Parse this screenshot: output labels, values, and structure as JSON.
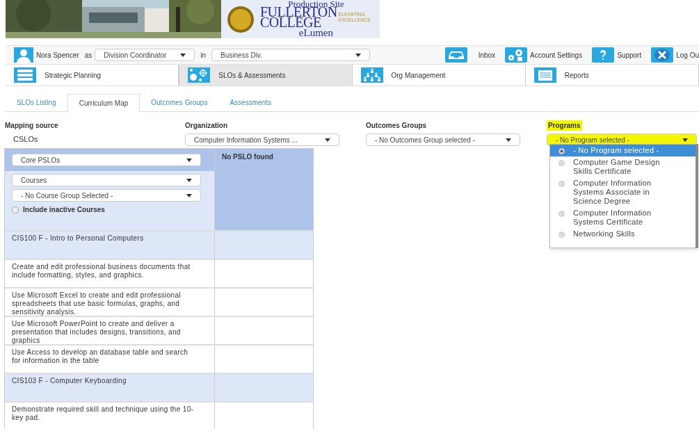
{
  "banner": {
    "site_label": "Production Site",
    "college_name": [
      "FULLERTON",
      "COLLEGE"
    ],
    "tagline": [
      "ELEVATING.",
      "EXCELLENCE."
    ],
    "product": "eLumen"
  },
  "user_bar": {
    "user": "Nora Spencer",
    "as_label": "as",
    "role": "Division Coordinator",
    "in_label": "in",
    "division": "Business Div.",
    "links": [
      {
        "label": "Inbox",
        "kind": "inbox"
      },
      {
        "label": "Account Settings",
        "kind": "settings"
      },
      {
        "label": "Support",
        "kind": "help"
      },
      {
        "label": "Log Ou",
        "kind": "logout"
      }
    ]
  },
  "modules": [
    {
      "label": "Strategic Planning",
      "kind": "planning",
      "selected": false
    },
    {
      "label": "SLOs & Assessments",
      "kind": "slo",
      "selected": true
    },
    {
      "label": "Org Management",
      "kind": "org",
      "selected": false
    },
    {
      "label": "Reports",
      "kind": "reports",
      "selected": false
    }
  ],
  "tabs": [
    {
      "label": "SLOs Listing",
      "selected": false
    },
    {
      "label": "Curriculum Map",
      "selected": true
    },
    {
      "label": "Outcomes Groups",
      "selected": false
    },
    {
      "label": "Assessments",
      "selected": false
    }
  ],
  "filters": {
    "mapping_source": {
      "label": "Mapping source",
      "value": "CSLOs"
    },
    "organization": {
      "label": "Organization",
      "value": "Computer Information Systems ..."
    },
    "outcomes_groups": {
      "label": "Outcomes Groups",
      "value": "- No Outcomes Group selected -"
    },
    "programs": {
      "label": "Programs",
      "value": "- No Program selected -",
      "highlighted": true,
      "options": [
        {
          "label": "- No Program selected -",
          "selected": true
        },
        {
          "label": "Computer Game Design Skills Certificate",
          "selected": false
        },
        {
          "label": "Computer Information Systems Associate in Science Degree",
          "selected": false
        },
        {
          "label": "Computer Information Systems Certificate",
          "selected": false
        },
        {
          "label": "Networking Skills",
          "selected": false
        }
      ]
    }
  },
  "map": {
    "pslo_select": "Core PSLOs",
    "course_type_select": "Courses",
    "course_group_select": "- No Course Group Selected -",
    "include_inactive": {
      "label": "Include inactive Courses",
      "checked": false
    },
    "pslo_header": "No PSLO found",
    "rows": [
      {
        "kind": "course",
        "text": "CIS100 F - Intro to Personal Computers"
      },
      {
        "kind": "outcome",
        "text": "Create and edit professional business documents that include formatting, styles, and graphics."
      },
      {
        "kind": "outcome",
        "text": "Use Microsoft Excel to create and edit professional spreadsheets that use basic formulas, graphs, and sensitivity analysis."
      },
      {
        "kind": "outcome",
        "text": "Use Microsoft PowerPoint to create and deliver a presentation that includes designs, transitions, and graphics"
      },
      {
        "kind": "outcome",
        "text": "Use Access to develop an database table and search for information in the table"
      },
      {
        "kind": "course",
        "text": "CIS103 F - Computer Keyboarding"
      },
      {
        "kind": "outcome",
        "text": "Demonstrate required skill and technique using the 10-key pad."
      }
    ]
  }
}
